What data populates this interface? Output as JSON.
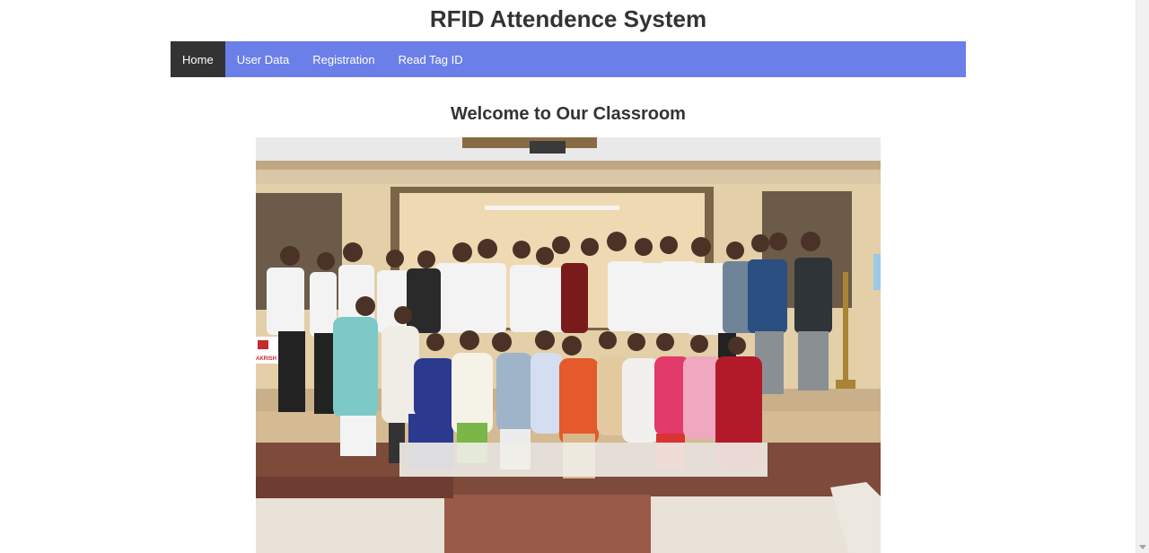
{
  "header": {
    "title": "RFID Attendence System"
  },
  "nav": {
    "items": [
      {
        "label": "Home",
        "active": true
      },
      {
        "label": "User Data",
        "active": false
      },
      {
        "label": "Registration",
        "active": false
      },
      {
        "label": "Read Tag ID",
        "active": false
      }
    ]
  },
  "main": {
    "heading": "Welcome to Our Classroom",
    "photo": {
      "banner_text": "AKRISH"
    }
  },
  "colors": {
    "nav_background": "#6b7fe8",
    "nav_active": "#333333",
    "title_text": "#333333"
  }
}
